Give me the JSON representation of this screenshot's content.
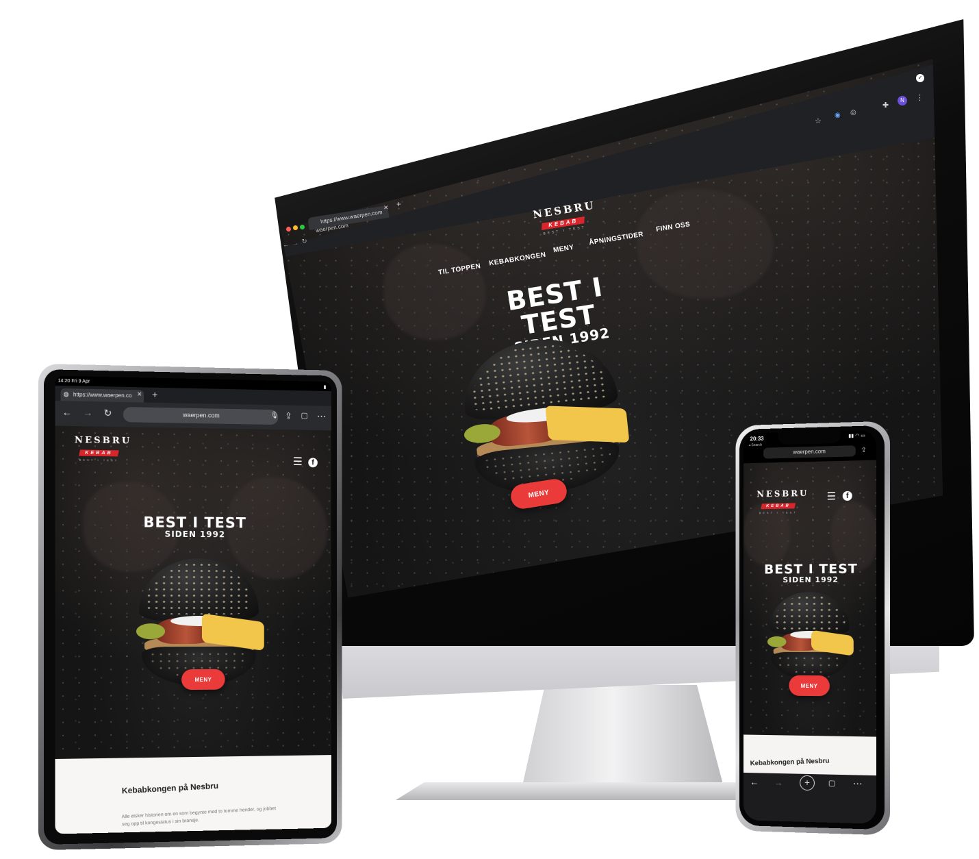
{
  "imac": {
    "browser": {
      "tab_title": "https://www.waerpen.com",
      "url": "waerpen.com"
    },
    "site": {
      "logo_top": "NESBRU",
      "logo_ribbon": "KEBAB",
      "logo_sub": "BEST I TEST",
      "nav": [
        "TIL TOPPEN",
        "KEBABKONGEN",
        "MENY",
        "ÅPNINGSTIDER",
        "FINN OSS"
      ],
      "headline": "BEST I TEST",
      "subheadline": "SIDEN 1992",
      "cta": "MENY"
    }
  },
  "ipad": {
    "status_time": "14:20  Fri 9 Apr",
    "tab_title": "https://www.waerpen.co",
    "url": "waerpen.com",
    "site": {
      "logo_top": "NESBRU",
      "logo_ribbon": "KEBAB",
      "logo_sub": "BEST I TEST",
      "headline": "BEST I TEST",
      "subheadline": "SIDEN 1992",
      "cta": "MENY",
      "section_title": "Kebabkongen på Nesbru",
      "section_text": "Alle elsker historien om en som begynte med to tomme hender, og jobbet seg opp til kongestatus i sin bransje."
    }
  },
  "iphone": {
    "status_time": "20:33",
    "back_label": "◂ Search",
    "url": "waerpen.com",
    "site": {
      "logo_top": "NESBRU",
      "logo_ribbon": "KEBAB",
      "logo_sub": "BEST I TEST",
      "headline": "BEST I TEST",
      "subheadline": "SIDEN 1992",
      "cta": "MENY",
      "section_title": "Kebabkongen på Nesbru"
    }
  },
  "colors": {
    "accent": "#ea3a3a",
    "logo_red": "#d8262c",
    "site_bg": "#151515",
    "browser_chrome": "#202124"
  },
  "icons": [
    "hamburger-menu-icon",
    "facebook-icon",
    "back-arrow-icon",
    "forward-arrow-icon",
    "reload-icon",
    "star-icon",
    "extensions-icon",
    "share-icon",
    "tabs-icon",
    "more-icon",
    "microphone-icon",
    "lock-icon",
    "plus-icon",
    "close-icon"
  ]
}
